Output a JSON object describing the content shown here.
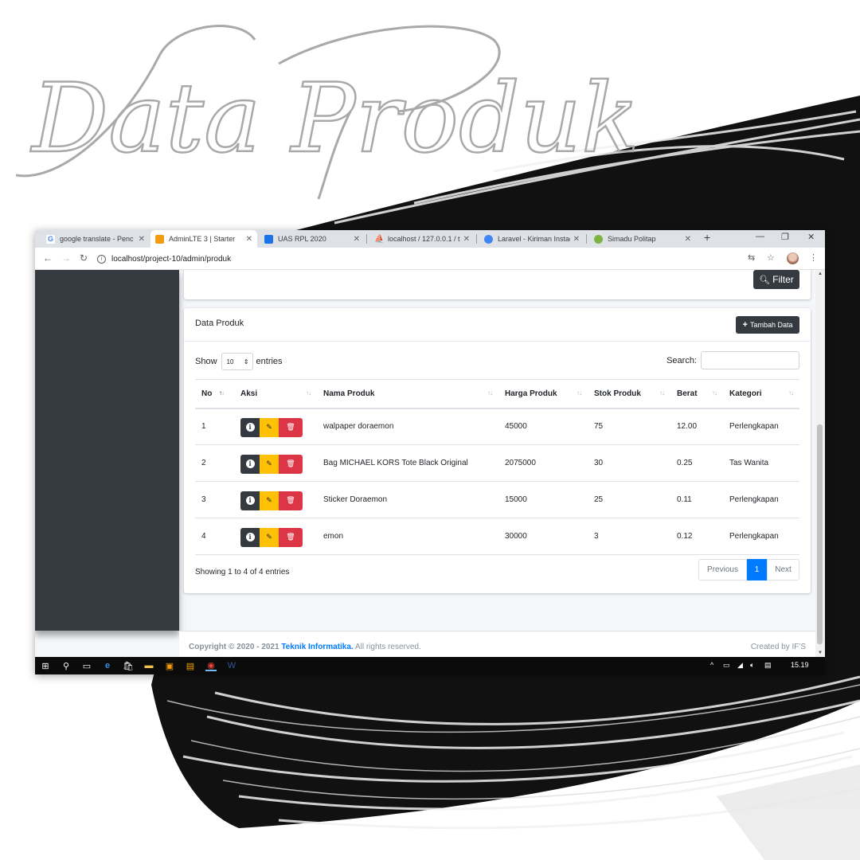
{
  "heading": "Data Produk",
  "browser": {
    "tabs": [
      {
        "label": "google translate - Penc",
        "active": false,
        "icon": "google-icon"
      },
      {
        "label": "AdminLTE 3 | Starter",
        "active": true,
        "icon": "adminlte-icon"
      },
      {
        "label": "UAS RPL 2020",
        "active": false,
        "icon": "classroom-icon"
      },
      {
        "label": "localhost / 127.0.0.1 / t",
        "active": false,
        "icon": "phpmyadmin-icon"
      },
      {
        "label": "Laravel - Kiriman Instag",
        "active": false,
        "icon": "chrome-icon"
      },
      {
        "label": "Simadu Politap",
        "active": false,
        "icon": "site-icon"
      }
    ],
    "url": "localhost/project-10/admin/produk"
  },
  "filter_button": "Filter",
  "card": {
    "title": "Data Produk",
    "add_button": "Tambah Data"
  },
  "datatable": {
    "show_label": "Show",
    "page_length": "10",
    "entries_label": "entries",
    "search_label": "Search:",
    "search_value": "",
    "columns": [
      "No",
      "Aksi",
      "Nama Produk",
      "Harga Produk",
      "Stok Produk",
      "Berat",
      "Kategori"
    ],
    "rows": [
      {
        "no": "1",
        "nama": "walpaper doraemon",
        "harga": "45000",
        "stok": "75",
        "berat": "12.00",
        "kategori": "Perlengkapan"
      },
      {
        "no": "2",
        "nama": "Bag MICHAEL KORS Tote Black Original",
        "harga": "2075000",
        "stok": "30",
        "berat": "0.25",
        "kategori": "Tas Wanita"
      },
      {
        "no": "3",
        "nama": "Sticker Doraemon",
        "harga": "15000",
        "stok": "25",
        "berat": "0.11",
        "kategori": "Perlengkapan"
      },
      {
        "no": "4",
        "nama": "emon",
        "harga": "30000",
        "stok": "3",
        "berat": "0.12",
        "kategori": "Perlengkapan"
      }
    ],
    "info": "Showing 1 to 4 of 4 entries",
    "pagination": {
      "previous": "Previous",
      "current": "1",
      "next": "Next"
    }
  },
  "footer": {
    "copyright_prefix": "Copyright © 2020 - 2021",
    "link": "Teknik Informatika.",
    "suffix": "All rights reserved.",
    "created_by": "Created by IF'S"
  },
  "taskbar": {
    "time": "15.19"
  },
  "colors": {
    "sidebar": "#343a40",
    "primary": "#007bff",
    "warning": "#ffc107",
    "danger": "#dc3545",
    "dark": "#343a40"
  }
}
